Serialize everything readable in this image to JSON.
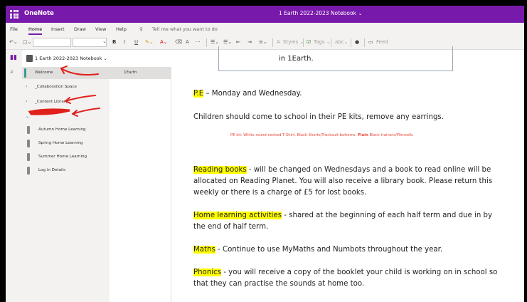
{
  "app": {
    "name": "OneNote",
    "document_title": "1 Earth 2022-2023 Notebook ⌄"
  },
  "menu": {
    "items": [
      "File",
      "Home",
      "Insert",
      "Draw",
      "View",
      "Help"
    ],
    "active": "Home",
    "tell_me_placeholder": "Tell me what you want to do"
  },
  "ribbon": {
    "styles_label": "Styles ⌄",
    "tags_label": "Tags ⌄",
    "feed_label": "Feed"
  },
  "notebook": {
    "name": "1 Earth 2022-2023 Notebook ⌄"
  },
  "sections": [
    {
      "label": "Welcome",
      "selected": true
    },
    {
      "label": "_Collaboration Space"
    },
    {
      "label": "_Content Library"
    },
    {
      "label": "",
      "redacted": true
    },
    {
      "label": "Autumn Home Learning",
      "child": true
    },
    {
      "label": "Spring Home Learning",
      "child": true
    },
    {
      "label": "Summer Home Learning",
      "child": true
    },
    {
      "label": "Log in Details",
      "child": true
    }
  ],
  "pages": [
    {
      "label": "1Earth"
    }
  ],
  "content": {
    "box_text": "in 1Earth.",
    "pe_label": "P.E",
    "pe_text": " – Monday and Wednesday.",
    "kits_text": "Children should come to school in their PE kits, remove any earrings.",
    "kit_detail_1": "PE kit: White round necked T-Shirt, Black Shorts/Tracksuit bottoms. ",
    "kit_detail_bold": "Plain",
    "kit_detail_2": " Black trainers/Plimsolls",
    "reading_label": "Reading books",
    "reading_line1": " - will be changed on Wednesdays and a book to read online will be",
    "reading_line2": "allocated on Reading Planet. You will also receive a library book. Please return this",
    "reading_line3": "weekly or there is a charge of £5 for lost books.",
    "home_label": "Home learning activities",
    "home_line1": " - shared at the beginning of each half term and due in by",
    "home_line2": "the end of half term.",
    "maths_label": "Maths",
    "maths_text": " - Continue to use MyMaths and Numbots throughout the year.",
    "phonics_label": "Phonics",
    "phonics_line1": " - you will receive a copy of the booklet your child is working on in school so",
    "phonics_line2": "that they can practise the sounds at home too."
  },
  "colors": {
    "brand": "#7719aa",
    "highlight": "#ffff00",
    "annotation": "#e0201b",
    "kit_text": "#e8473a"
  },
  "icons": [
    "app-launcher-icon",
    "notebooks-icon",
    "search-icon",
    "undo-icon",
    "bold-icon",
    "italic-icon",
    "underline-icon",
    "mic-icon"
  ]
}
